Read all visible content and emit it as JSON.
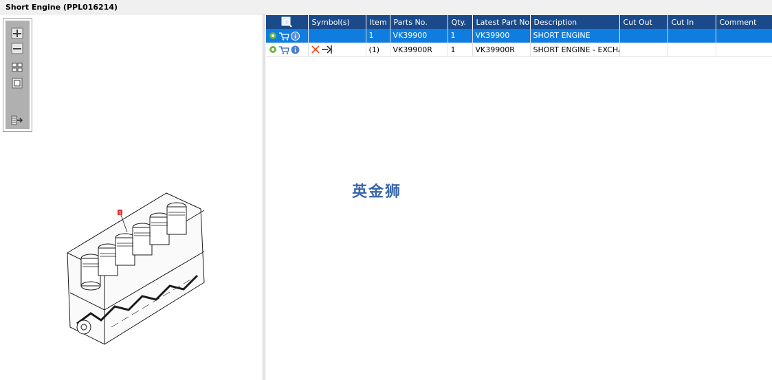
{
  "window": {
    "title": "Short Engine (PPL016214)"
  },
  "toolbar": {
    "buttons": [
      {
        "name": "zoom-in",
        "icon": "zoom-in-icon"
      },
      {
        "name": "zoom-out",
        "icon": "zoom-out-icon"
      },
      {
        "name": "fit-all",
        "icon": "fit-all-icon"
      },
      {
        "name": "fit-window",
        "icon": "fit-window-icon"
      },
      {
        "name": "export",
        "icon": "export-list-icon"
      }
    ]
  },
  "drawing": {
    "callout": "1"
  },
  "grid": {
    "columns": [
      "",
      "Symbol(s)",
      "Item",
      "Parts No.",
      "Qty.",
      "Latest Part No.",
      "Description",
      "Cut Out",
      "Cut In",
      "Comment"
    ],
    "rows": [
      {
        "item": "1",
        "parts_no": "VK39900",
        "qty": "1",
        "latest_part_no": "VK39900",
        "description": "SHORT ENGINE",
        "cut_out": "",
        "cut_in": "",
        "comment": "",
        "selected": true
      },
      {
        "item": "(1)",
        "parts_no": "VK39900R",
        "qty": "1",
        "latest_part_no": "VK39900R",
        "description": "SHORT ENGINE - EXCHAN",
        "cut_out": "",
        "cut_in": "",
        "comment": "",
        "selected": false
      }
    ]
  },
  "watermark": {
    "text": "英金狮"
  },
  "colors": {
    "header": "#1a4a8a",
    "selected_row": "#0f7de0",
    "callout": "#e03030"
  }
}
